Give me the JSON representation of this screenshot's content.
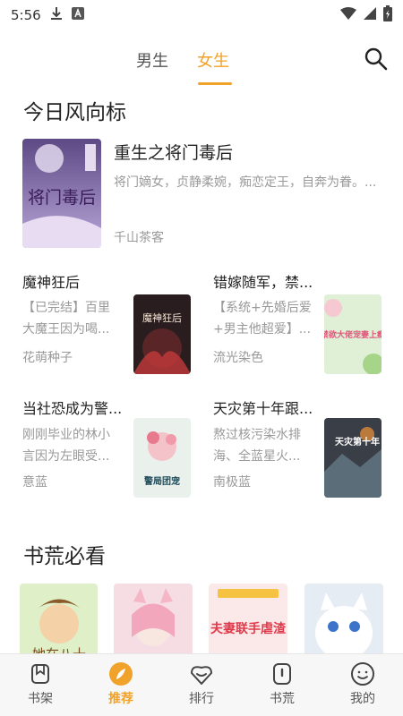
{
  "status_bar": {
    "time": "5:56"
  },
  "tabs": [
    {
      "label": "男生",
      "active": false
    },
    {
      "label": "女生",
      "active": true
    }
  ],
  "colors": {
    "accent": "#f0a22a"
  },
  "section1": {
    "title": "今日风向标",
    "featured": {
      "title": "重生之将门毒后",
      "description": "将门嫡女，贞静柔婉，痴恋定王，自奔为眷。...",
      "author": "千山茶客",
      "cover_text": "将门毒后"
    },
    "books": [
      {
        "title": "魔神狂后",
        "description": "【已完结】百里大魔王因为喝...",
        "author": "花萌种子",
        "cover_text": "魔神狂后"
      },
      {
        "title": "错嫁随军，禁...",
        "description": "【系统+先婚后爱+男主他超爱】...",
        "author": "流光染色",
        "cover_text": "禁欲大佬宠妻上瘾"
      },
      {
        "title": "当社恐成为警...",
        "description": "刚刚毕业的林小言因为左眼受...",
        "author": "意蓝",
        "cover_text": "警局团宠"
      },
      {
        "title": "天灾第十年跟...",
        "description": "熬过核污染水排海、全蓝星火...",
        "author": "南极蓝",
        "cover_text": "天灾第十年"
      }
    ]
  },
  "section2": {
    "title": "书荒必看",
    "covers": [
      {
        "cover_text": "她在八十"
      },
      {
        "cover_text": ""
      },
      {
        "cover_text": "夫妻联手虐渣"
      },
      {
        "cover_text": ""
      }
    ]
  },
  "bottom_nav": [
    {
      "label": "书架",
      "icon": "bookshelf-icon",
      "active": false
    },
    {
      "label": "推荐",
      "icon": "recommend-icon",
      "active": true
    },
    {
      "label": "排行",
      "icon": "ranking-icon",
      "active": false
    },
    {
      "label": "书荒",
      "icon": "book-famine-icon",
      "active": false
    },
    {
      "label": "我的",
      "icon": "profile-icon",
      "active": false
    }
  ]
}
